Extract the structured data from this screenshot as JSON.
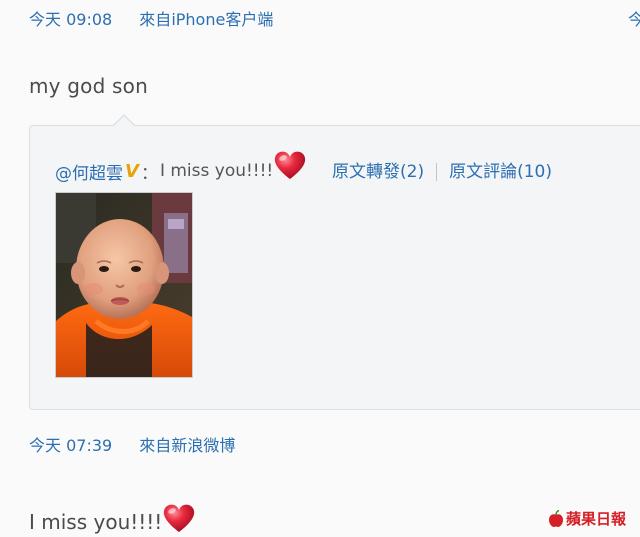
{
  "posts": [
    {
      "time": "今天 09:08",
      "via_prefix": "來自",
      "via_source": "iPhone客户端",
      "text": "my god son"
    },
    {
      "time": "今天 07:39",
      "via_prefix": "來自",
      "via_source": "新浪微博",
      "text": "I miss you!!!!"
    }
  ],
  "top_right_mark": "今",
  "repost": {
    "user": "@何超雲",
    "verified_badge": "V",
    "colon": "：",
    "text": "I miss you!!!!",
    "forward_link": "原文轉發(2)",
    "comment_link": "原文評論(10)",
    "image_icon": "baby-photo"
  },
  "watermark": "蘋果日報",
  "colors": {
    "link": "#2b6fb2",
    "heart": "#e0283c",
    "verified": "#e8a10a",
    "watermark": "#d42026"
  }
}
